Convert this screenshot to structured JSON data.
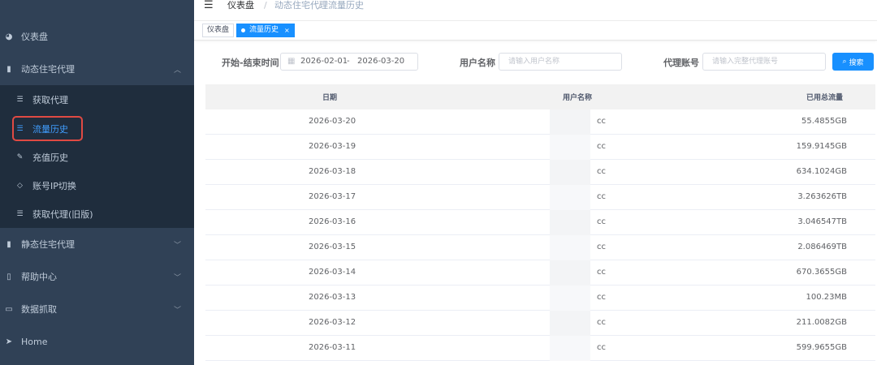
{
  "sidebar": {
    "items": [
      {
        "label": "仪表盘",
        "icon": "dashboard-icon"
      },
      {
        "label": "动态住宅代理",
        "icon": "bar-chart-icon",
        "expanded": true
      },
      {
        "label": "静态住宅代理",
        "icon": "bar-chart-icon"
      },
      {
        "label": "帮助中心",
        "icon": "book-icon"
      },
      {
        "label": "数据抓取",
        "icon": "monitor-icon"
      },
      {
        "label": "Home",
        "icon": "send-icon"
      }
    ],
    "submenu": [
      {
        "label": "获取代理",
        "icon": "list-icon"
      },
      {
        "label": "流量历史",
        "icon": "list-icon",
        "active": true
      },
      {
        "label": "充值历史",
        "icon": "edit-icon"
      },
      {
        "label": "账号IP切换",
        "icon": "shield-icon"
      },
      {
        "label": "获取代理(旧版)",
        "icon": "list-icon"
      }
    ]
  },
  "header": {
    "breadcrumb": [
      "仪表盘",
      "动态住宅代理",
      "流量历史"
    ],
    "separator": "/"
  },
  "tags": [
    {
      "label": "仪表盘"
    },
    {
      "label": "流量历史",
      "close": "×"
    }
  ],
  "filters": {
    "date_label": "开始-结束时间",
    "date_start": "2026-02-01",
    "date_sep": "-",
    "date_end": "2026-03-20",
    "username_label": "用户名称",
    "username_placeholder": "请输入用户名称",
    "proxy_label": "代理账号",
    "proxy_placeholder": "请输入完整代理账号",
    "search_label": "搜索"
  },
  "table": {
    "columns": [
      "日期",
      "用户名称",
      "已用总流量"
    ],
    "rows": [
      {
        "date": "2026-03-20",
        "user": "cc",
        "traffic": "55.4855GB"
      },
      {
        "date": "2026-03-19",
        "user": "cc",
        "traffic": "159.9145GB"
      },
      {
        "date": "2026-03-18",
        "user": "cc",
        "traffic": "634.1024GB"
      },
      {
        "date": "2026-03-17",
        "user": "cc",
        "traffic": "3.263626TB"
      },
      {
        "date": "2026-03-16",
        "user": "cc",
        "traffic": "3.046547TB"
      },
      {
        "date": "2026-03-15",
        "user": "cc",
        "traffic": "2.086469TB"
      },
      {
        "date": "2026-03-14",
        "user": "cc",
        "traffic": "670.3655GB"
      },
      {
        "date": "2026-03-13",
        "user": "cc",
        "traffic": "100.23MB"
      },
      {
        "date": "2026-03-12",
        "user": "cc",
        "traffic": "211.0082GB"
      },
      {
        "date": "2026-03-11",
        "user": "cc",
        "traffic": "599.9655GB"
      }
    ]
  },
  "colors": {
    "sidebar_bg": "#304156",
    "submenu_bg": "#1f2d3d",
    "accent": "#1890ff",
    "highlight": "#e04a43"
  }
}
